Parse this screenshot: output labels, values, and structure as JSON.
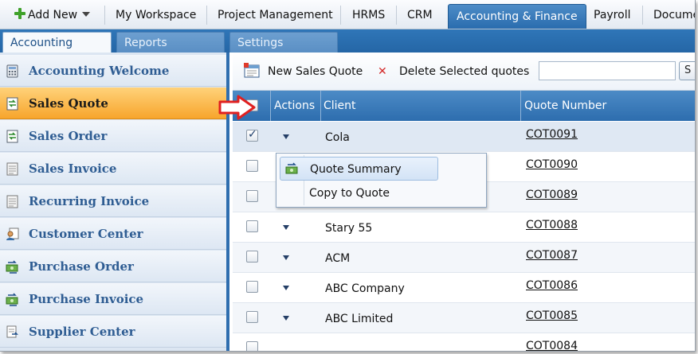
{
  "topnav": {
    "add_new": "Add New",
    "tabs": [
      "My Workspace",
      "Project Management",
      "HRMS",
      "CRM",
      "Accounting & Finance",
      "Payroll",
      "Docume"
    ],
    "active_tab": "Accounting & Finance"
  },
  "subtabs": [
    "Accounting",
    "Reports",
    "Settings"
  ],
  "sidebar": {
    "items": [
      {
        "label": "Accounting Welcome",
        "icon": "calculator-icon"
      },
      {
        "label": "Sales Quote",
        "icon": "document-arrows-icon",
        "selected": true
      },
      {
        "label": "Sales Order",
        "icon": "document-arrows-icon"
      },
      {
        "label": "Sales Invoice",
        "icon": "document-icon"
      },
      {
        "label": "Recurring Invoice",
        "icon": "document-icon"
      },
      {
        "label": "Customer Center",
        "icon": "customer-icon"
      },
      {
        "label": "Purchase Order",
        "icon": "money-arrows-icon"
      },
      {
        "label": "Purchase Invoice",
        "icon": "money-arrows-icon"
      },
      {
        "label": "Supplier Center",
        "icon": "supplier-icon"
      }
    ]
  },
  "toolbar": {
    "new_label": "New Sales Quote",
    "delete_label": "Delete Selected quotes",
    "search_button": "S"
  },
  "grid": {
    "headers": {
      "actions": "Actions",
      "client": "Client",
      "quote_number": "Quote Number"
    },
    "rows": [
      {
        "client": "Cola",
        "quote": "COT0091",
        "checked": true
      },
      {
        "client": "",
        "quote": "COT0090",
        "checked": false
      },
      {
        "client": "",
        "quote": "COT0089",
        "checked": false
      },
      {
        "client": "Stary 55",
        "quote": "COT0088",
        "checked": false
      },
      {
        "client": "ACM",
        "quote": "COT0087",
        "checked": false
      },
      {
        "client": "ABC Company",
        "quote": "COT0086",
        "checked": false
      },
      {
        "client": "ABC Limited",
        "quote": "COT0085",
        "checked": false
      },
      {
        "client": "",
        "quote": "COT0084",
        "checked": false
      }
    ]
  },
  "popup_menu": {
    "items": [
      "Quote Summary",
      "Copy to Quote"
    ]
  },
  "colors": {
    "accent_blue": "#2d6dae",
    "selected_orange": "#f7a52c",
    "callout_red": "#e02020"
  }
}
